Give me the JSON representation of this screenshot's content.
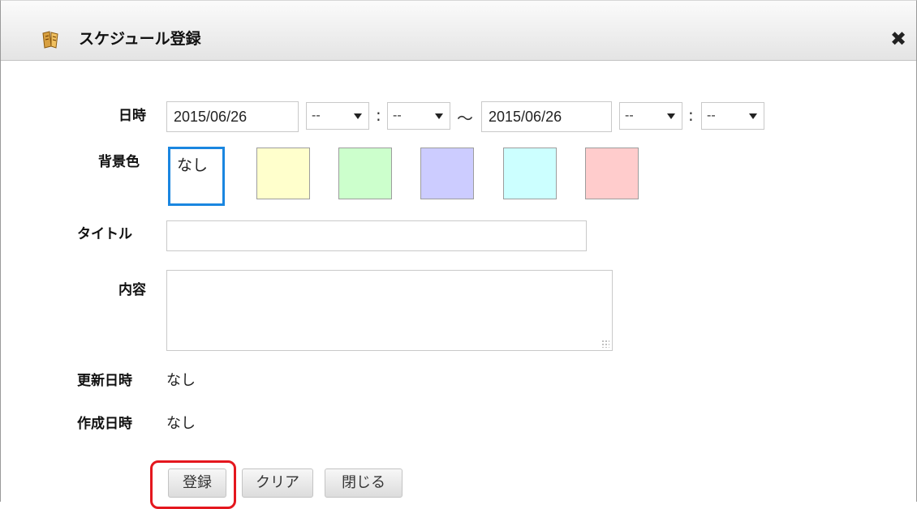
{
  "dialog": {
    "title": "スケジュール登録",
    "close_symbol": "✖"
  },
  "form": {
    "datetime": {
      "label": "日時",
      "start_date": "2015/06/26",
      "start_hour": "--",
      "start_minute": "--",
      "time_sep": ":",
      "range_sep": "～",
      "end_date": "2015/06/26",
      "end_hour": "--",
      "end_minute": "--"
    },
    "bgcolor": {
      "label": "背景色",
      "options": [
        {
          "label": "なし",
          "color": "#ffffff",
          "selected": true
        },
        {
          "label": "",
          "color": "#ffffcc"
        },
        {
          "label": "",
          "color": "#ccffcc"
        },
        {
          "label": "",
          "color": "#ccccff"
        },
        {
          "label": "",
          "color": "#ccffff"
        },
        {
          "label": "",
          "color": "#ffcccc"
        }
      ]
    },
    "title": {
      "label": "タイトル",
      "value": ""
    },
    "content": {
      "label": "内容",
      "value": ""
    },
    "updated": {
      "label": "更新日時",
      "value": "なし"
    },
    "created": {
      "label": "作成日時",
      "value": "なし"
    }
  },
  "buttons": {
    "register": "登録",
    "clear": "クリア",
    "close": "閉じる"
  },
  "colors": {
    "selected_border": "#1a86e0",
    "highlight": "#e4171e"
  }
}
